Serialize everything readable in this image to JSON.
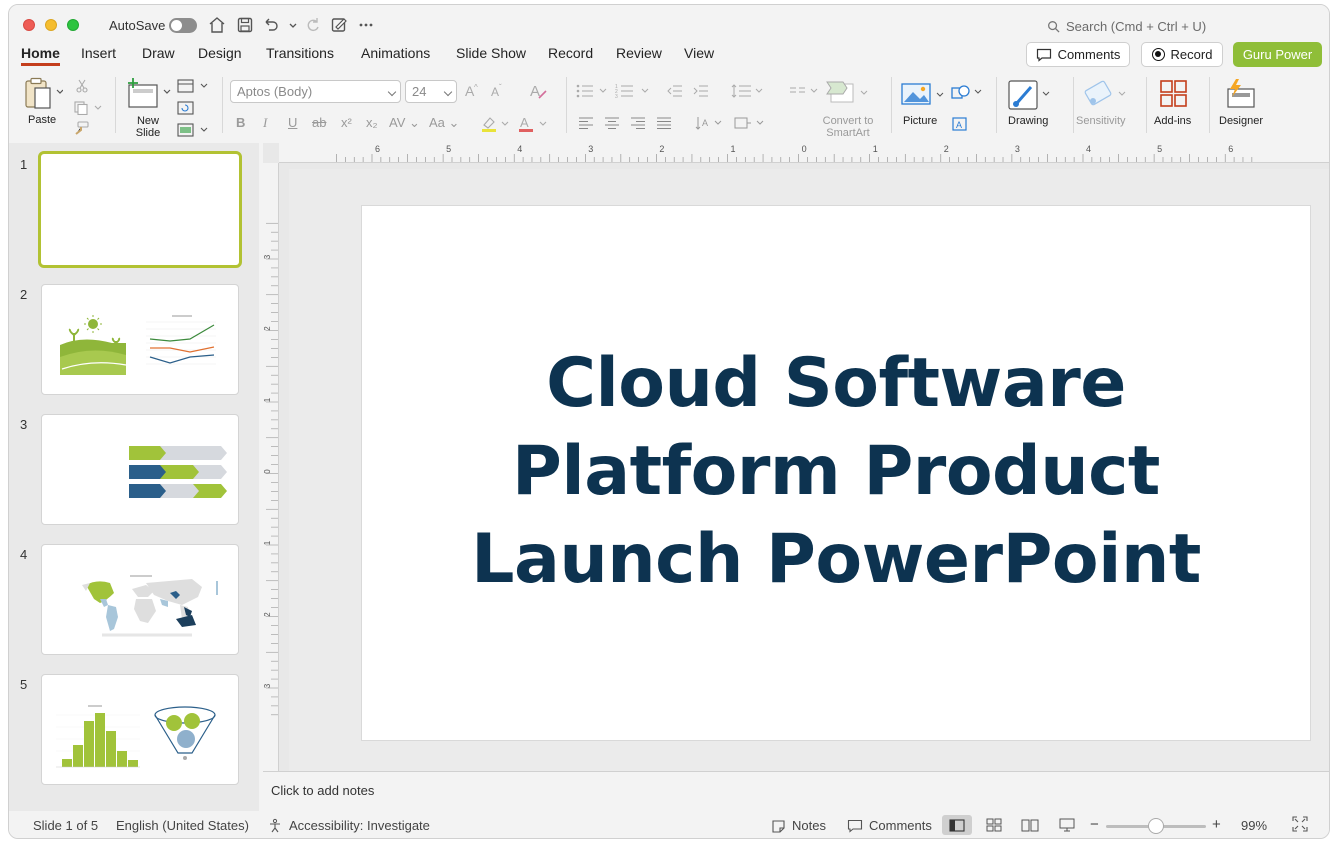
{
  "titlebar": {
    "autosave_label": "AutoSave",
    "search_placeholder": "Search (Cmd + Ctrl + U)"
  },
  "tabs": [
    {
      "label": "Home",
      "active": true
    },
    {
      "label": "Insert"
    },
    {
      "label": "Draw"
    },
    {
      "label": "Design"
    },
    {
      "label": "Transitions"
    },
    {
      "label": "Animations"
    },
    {
      "label": "Slide Show"
    },
    {
      "label": "Record"
    },
    {
      "label": "Review"
    },
    {
      "label": "View"
    }
  ],
  "actions": {
    "comments": "Comments",
    "record": "Record",
    "guru": "Guru Power"
  },
  "ribbon": {
    "paste": "Paste",
    "new_slide_1": "New",
    "new_slide_2": "Slide",
    "font_name": "Aptos (Body)",
    "font_size": "24",
    "convert_1": "Convert to",
    "convert_2": "SmartArt",
    "picture": "Picture",
    "drawing": "Drawing",
    "sensitivity": "Sensitivity",
    "addins": "Add-ins",
    "designer": "Designer"
  },
  "slides": [
    {
      "number": "1"
    },
    {
      "number": "2"
    },
    {
      "number": "3"
    },
    {
      "number": "4"
    },
    {
      "number": "5"
    }
  ],
  "slide": {
    "title_line1": "Cloud Software",
    "title_line2": "Platform Product",
    "title_line3": "Launch PowerPoint"
  },
  "ruler": {
    "h_ticks": [
      "6",
      "5",
      "4",
      "3",
      "2",
      "1",
      "0",
      "1",
      "2",
      "3",
      "4",
      "5",
      "6"
    ],
    "v_ticks": [
      "3",
      "2",
      "1",
      "0",
      "1",
      "2",
      "3"
    ]
  },
  "notes": {
    "placeholder": "Click to add notes"
  },
  "status": {
    "slide_info": "Slide 1 of 5",
    "language": "English (United States)",
    "accessibility": "Accessibility: Investigate",
    "notes": "Notes",
    "comments": "Comments",
    "zoom": "99%"
  },
  "colors": {
    "accent": "#c43e1c",
    "title_text": "#0d3350",
    "guru_green": "#8fbe38",
    "selected_border": "#b2c233"
  }
}
